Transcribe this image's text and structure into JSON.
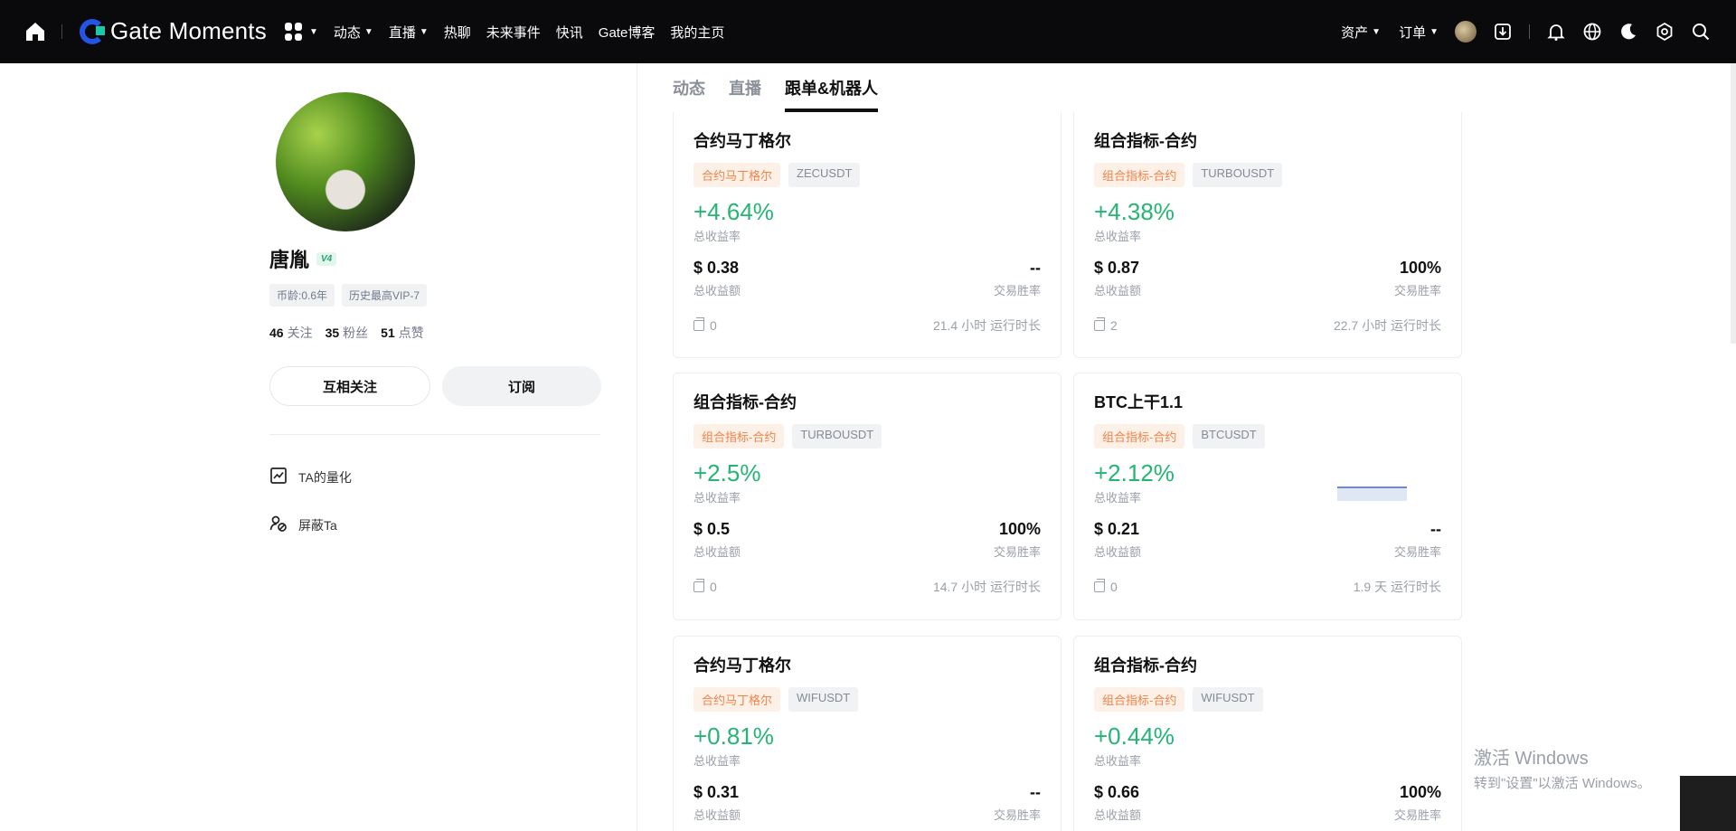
{
  "nav": {
    "brand": "Gate Moments",
    "items": [
      "动态",
      "直播",
      "热聊",
      "未来事件",
      "快讯",
      "Gate博客",
      "我的主页"
    ],
    "right": {
      "assets": "资产",
      "orders": "订单"
    }
  },
  "profile": {
    "name": "唐胤",
    "vip_badge": "V4",
    "tags": [
      "币龄:0.6年",
      "历史最高VIP-7"
    ],
    "stats": [
      {
        "num": "46",
        "label": "关注"
      },
      {
        "num": "35",
        "label": "粉丝"
      },
      {
        "num": "51",
        "label": "点赞"
      }
    ],
    "follow_btn": "互相关注",
    "subscribe_btn": "订阅",
    "links": [
      "TA的量化",
      "屏蔽Ta"
    ]
  },
  "tabs": [
    "动态",
    "直播",
    "跟单&机器人"
  ],
  "cards": [
    {
      "title": "合约马丁格尔",
      "tag": "合约马丁格尔",
      "symbol": "ZECUSDT",
      "pct": "+4.64%",
      "pct_label": "总收益率",
      "amount": "$ 0.38",
      "amount_label": "总收益额",
      "winrate": "--",
      "winrate_label": "交易胜率",
      "copies": "0",
      "runtime": "21.4 小时 运行时长"
    },
    {
      "title": "组合指标-合约",
      "tag": "组合指标-合约",
      "symbol": "TURBOUSDT",
      "pct": "+4.38%",
      "pct_label": "总收益率",
      "amount": "$ 0.87",
      "amount_label": "总收益额",
      "winrate": "100%",
      "winrate_label": "交易胜率",
      "copies": "2",
      "runtime": "22.7 小时 运行时长"
    },
    {
      "title": "组合指标-合约",
      "tag": "组合指标-合约",
      "symbol": "TURBOUSDT",
      "pct": "+2.5%",
      "pct_label": "总收益率",
      "amount": "$ 0.5",
      "amount_label": "总收益额",
      "winrate": "100%",
      "winrate_label": "交易胜率",
      "copies": "0",
      "runtime": "14.7 小时 运行时长"
    },
    {
      "title": "BTC上干1.1",
      "tag": "组合指标-合约",
      "symbol": "BTCUSDT",
      "pct": "+2.12%",
      "pct_label": "总收益率",
      "amount": "$ 0.21",
      "amount_label": "总收益额",
      "winrate": "--",
      "winrate_label": "交易胜率",
      "copies": "0",
      "runtime": "1.9 天 运行时长"
    },
    {
      "title": "合约马丁格尔",
      "tag": "合约马丁格尔",
      "symbol": "WIFUSDT",
      "pct": "+0.81%",
      "pct_label": "总收益率",
      "amount": "$ 0.31",
      "amount_label": "总收益额",
      "winrate": "--",
      "winrate_label": "交易胜率"
    },
    {
      "title": "组合指标-合约",
      "tag": "组合指标-合约",
      "symbol": "WIFUSDT",
      "pct": "+0.44%",
      "pct_label": "总收益率",
      "amount": "$ 0.66",
      "amount_label": "总收益额",
      "winrate": "100%",
      "winrate_label": "交易胜率"
    }
  ],
  "watermark": {
    "line1": "激活 Windows",
    "line2": "转到\"设置\"以激活 Windows。"
  },
  "colors": {
    "positive": "#24b574",
    "tag_orange": "#f0844a",
    "brand_blue": "#2354e6",
    "nav_bg": "#0a0a0c"
  },
  "icons": [
    "home-icon",
    "apps-grid-icon",
    "avatar-icon",
    "download-icon",
    "bell-icon",
    "globe-icon",
    "moon-icon",
    "settings-icon",
    "search-icon",
    "chart-icon",
    "block-icon",
    "copy-icon"
  ]
}
